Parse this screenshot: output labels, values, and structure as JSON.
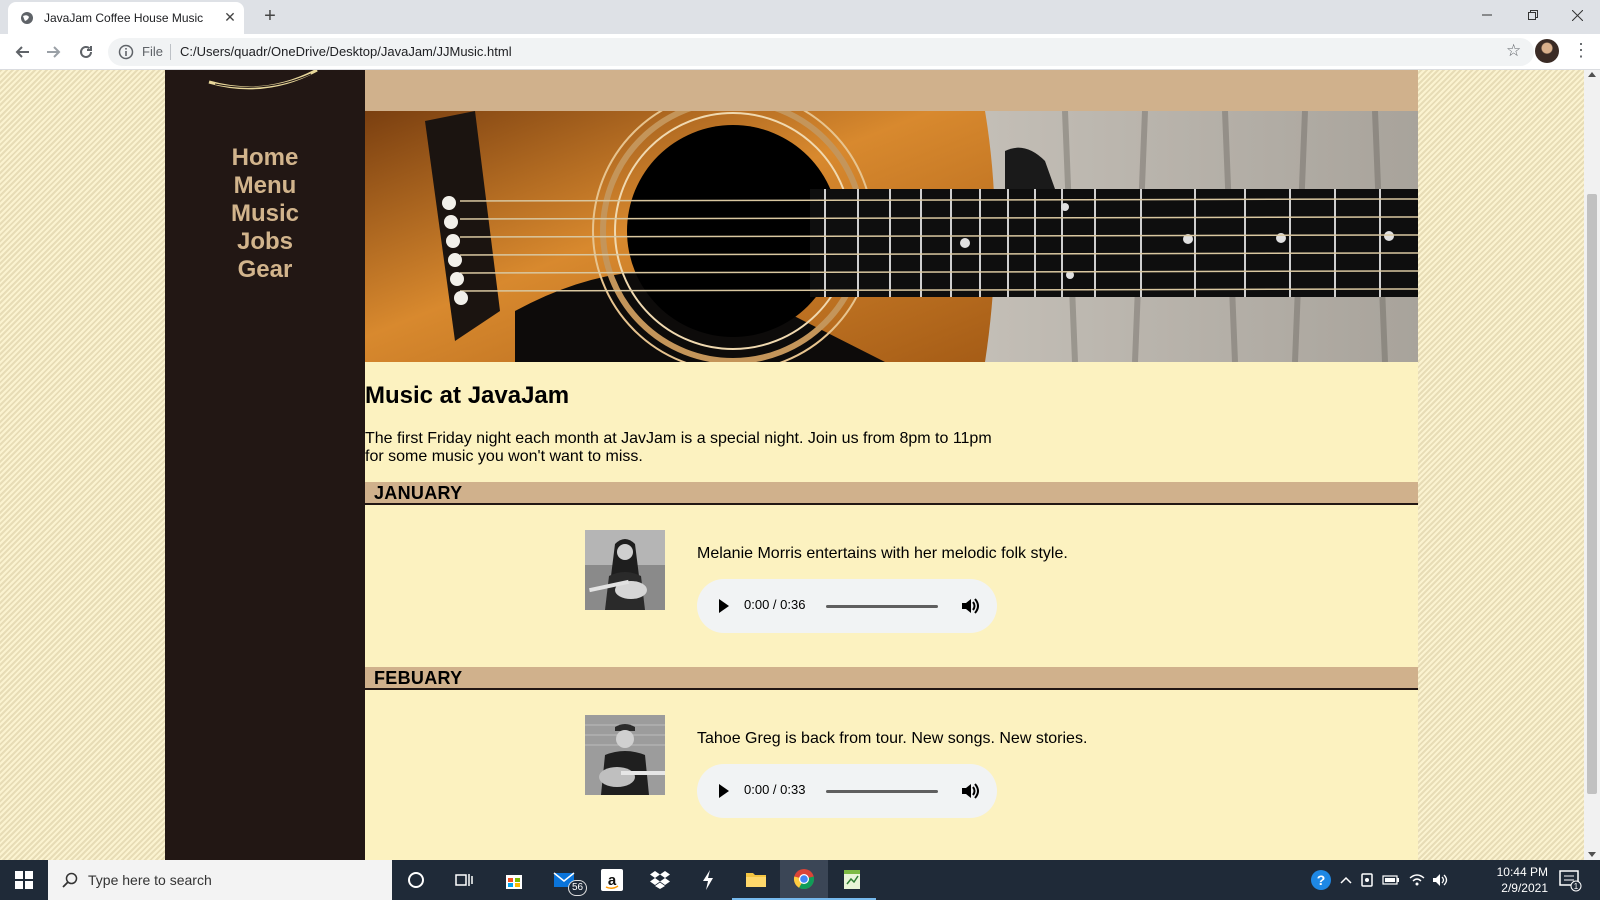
{
  "browser": {
    "tab_title": "JavaJam Coffee House Music",
    "omnibox_scheme": "File",
    "url": "C:/Users/quadr/OneDrive/Desktop/JavaJam/JJMusic.html"
  },
  "sidebar": {
    "nav": [
      {
        "label": "Home"
      },
      {
        "label": "Menu"
      },
      {
        "label": "Music"
      },
      {
        "label": "Jobs"
      },
      {
        "label": "Gear"
      }
    ]
  },
  "main": {
    "title": "Music at JavaJam",
    "intro_line1": "The first Friday night each month at JavJam is a special night. Join us from 8pm to 11pm",
    "intro_line2": "for some music you won't want to miss.",
    "months": [
      {
        "heading": "JANUARY",
        "description": "Melanie Morris entertains with her melodic folk style.",
        "audio_time": "0:00 / 0:36"
      },
      {
        "heading": "FEBUARY",
        "description": "Tahoe Greg is back from tour. New songs. New stories.",
        "audio_time": "0:00 / 0:33"
      }
    ]
  },
  "taskbar": {
    "search_placeholder": "Type here to search",
    "mail_badge": "56",
    "time": "10:44 PM",
    "date": "2/9/2021",
    "notification_count": "1"
  },
  "colors": {
    "sidebar_bg": "#221714",
    "nav_link": "#d2b48c",
    "content_bg": "#fcf2c0",
    "month_bar": "#d0b18c"
  }
}
